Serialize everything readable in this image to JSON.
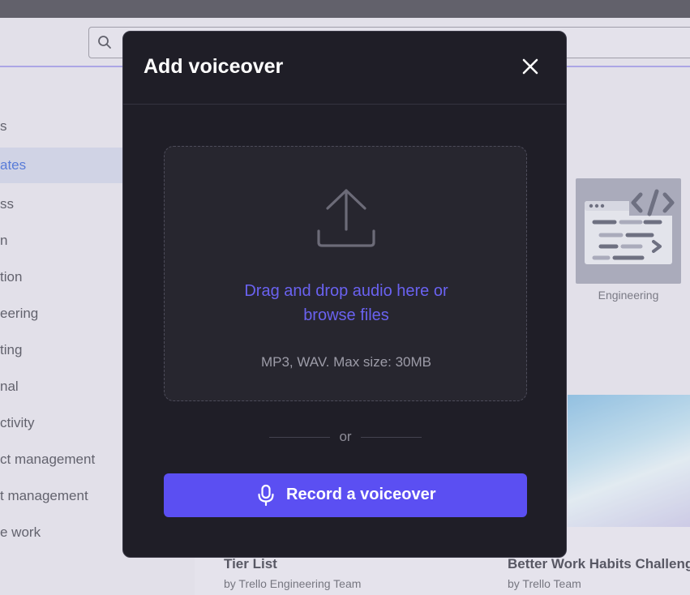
{
  "modal": {
    "title": "Add voiceover",
    "dropzone": {
      "line1": "Drag and drop audio here or",
      "line2": "browse files",
      "hint": "MP3, WAV. Max size: 30MB"
    },
    "divider_text": "or",
    "record_label": "Record a voiceover"
  },
  "background": {
    "sidebar_items": [
      "s",
      "ates",
      "ss",
      "n",
      "tion",
      "eering",
      "ting",
      "nal",
      "ctivity",
      "ct management",
      "t management",
      "e work"
    ],
    "active_index": 1,
    "engineering_label": "Engineering",
    "cards": [
      {
        "title": "Tier List",
        "sub": "by Trello Engineering Team"
      },
      {
        "title": "Better Work Habits Challenge",
        "sub": "by Trello Team"
      }
    ]
  },
  "colors": {
    "accent": "#5b4ff2",
    "link": "#6a62f0",
    "modal_bg": "#1f1e27"
  }
}
